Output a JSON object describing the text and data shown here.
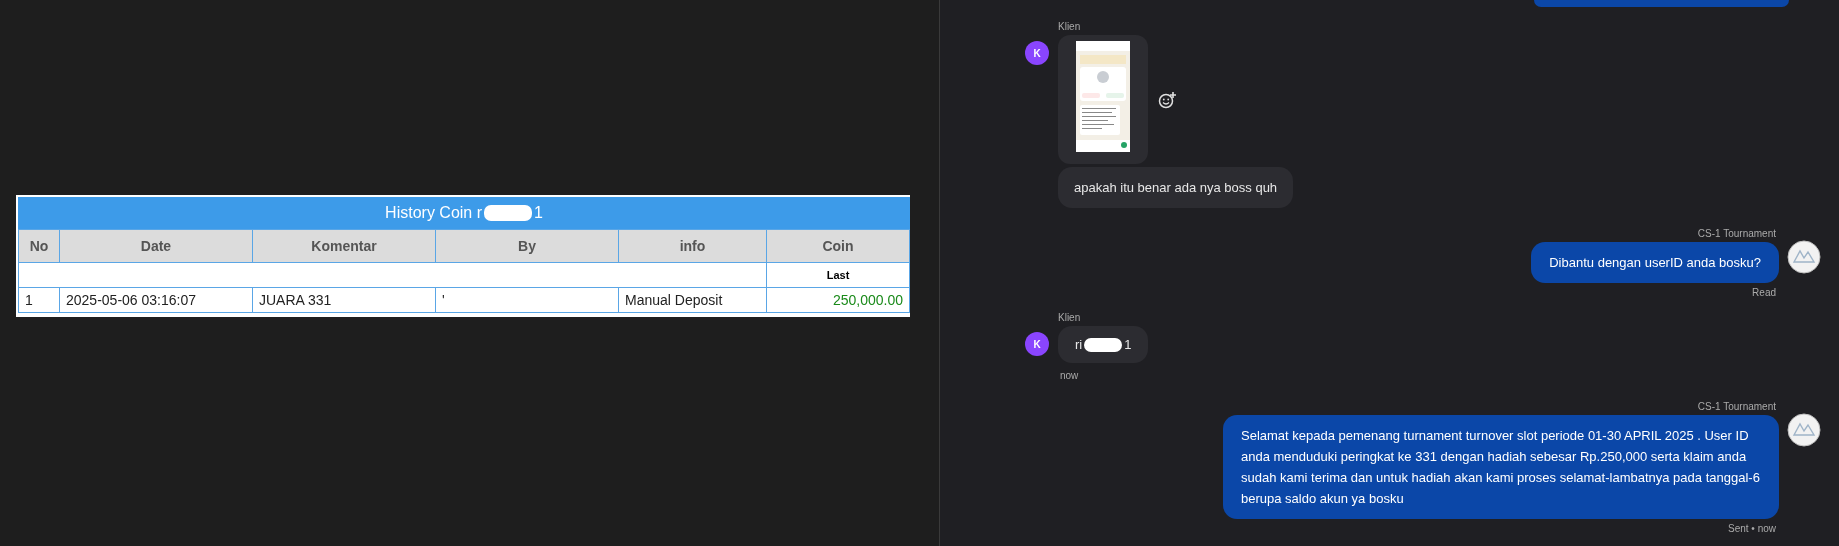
{
  "history_table": {
    "title_prefix": "History Coin r",
    "title_suffix": "1",
    "columns": [
      "No",
      "Date",
      "Komentar",
      "By",
      "info",
      "Coin"
    ],
    "subheader": "Last",
    "rows": [
      {
        "no": "1",
        "date": "2025-05-06 03:16:07",
        "komentar": "JUARA 331",
        "by": "'",
        "info": "Manual Deposit",
        "coin": "250,000.00"
      }
    ]
  },
  "chat": {
    "messages": [
      {
        "kind": "clipped"
      },
      {
        "kind": "incoming",
        "sender": "Klien",
        "avatar_letter": "K",
        "parts": [
          {
            "kind": "image"
          },
          {
            "kind": "text",
            "text": "apakah itu benar ada nya boss quh"
          }
        ]
      },
      {
        "kind": "outgoing",
        "sender": "CS-1 Tournament",
        "text": "Dibantu dengan userID anda bosku?",
        "status": "Read"
      },
      {
        "kind": "incoming",
        "sender": "Klien",
        "avatar_letter": "K",
        "parts": [
          {
            "kind": "redacted",
            "prefix": "ri",
            "suffix": "1"
          }
        ],
        "time": "now"
      },
      {
        "kind": "outgoing",
        "sender": "CS-1 Tournament",
        "text": "Selamat kepada pemenang turnament turnover slot periode 01-30 APRIL 2025 . User ID anda menduduki peringkat ke 331 dengan hadiah sebesar Rp.250,000 serta klaim anda sudah kami terima dan untuk hadiah akan kami proses selamat-lambatnya pada tanggal-6 berupa saldo akun ya bosku",
        "status": "Sent • now"
      }
    ]
  }
}
